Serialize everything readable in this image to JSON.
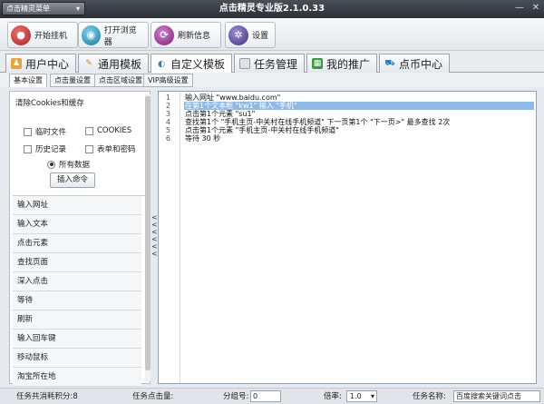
{
  "titlebar": {
    "menu_label": "点击精灵菜单",
    "menu_caret": "▾",
    "title": "点击精灵专业版2.1.0.33",
    "min": "—",
    "close": "✕"
  },
  "toolbar": {
    "buttons": [
      {
        "label": "开始挂机",
        "icon": "robot-icon",
        "color": "#c0392b"
      },
      {
        "label": "打开浏览器",
        "icon": "globe-icon",
        "color": "#1f8bb8"
      },
      {
        "label": "刷新信息",
        "icon": "refresh-icon",
        "color": "#8e2b8a"
      },
      {
        "label": "设置",
        "icon": "gear-icon",
        "color": "#4e3b8a"
      }
    ]
  },
  "tabs": [
    {
      "label": "用户中心",
      "icon": "user-icon"
    },
    {
      "label": "通用模板",
      "icon": "wand-icon"
    },
    {
      "label": "自定义模板",
      "icon": "custom-icon"
    },
    {
      "label": "任务管理",
      "icon": "task-icon"
    },
    {
      "label": "我的推广",
      "icon": "promo-icon"
    },
    {
      "label": "点币中心",
      "icon": "cart-icon"
    }
  ],
  "active_tab": 2,
  "subtabs": [
    "基本设置",
    "点击量设置",
    "点击区域设置",
    "VIP高级设置"
  ],
  "left": {
    "group_title": "清除Cookies和缓存",
    "checkboxes": [
      {
        "label": "临时文件",
        "checked": false
      },
      {
        "label": "COOKIES",
        "checked": false
      },
      {
        "label": "历史记录",
        "checked": false
      },
      {
        "label": "表单和密码",
        "checked": false
      }
    ],
    "radio_label": "所有数据",
    "insert_button": "插入命令",
    "commands": [
      "输入网址",
      "输入文本",
      "点击元素",
      "查找页面",
      "深入点击",
      "等待",
      "刷新",
      "输入回车键",
      "移动鼠标",
      "淘宝所在地"
    ]
  },
  "collapse_arrows": "<\n<\n<\n<\n<\n<",
  "editor": {
    "line_numbers": [
      "1",
      "2",
      "3",
      "4",
      "5",
      "6"
    ],
    "lines": [
      "输入网址 \"www.baidu.com\"",
      "在第1个文本框 \"kw1\" 输入 \"手机\"",
      "点击第1个元素 \"su1\"",
      "查找第1个 \"手机主页-中关村在线手机频道\" 下一页第1个 \"下一页>\" 最多查找 2次",
      "点击第1个元素 \"手机主页-中关村在线手机频道\"",
      "等待 30 秒"
    ],
    "selected_line": 2
  },
  "status": {
    "points_label": "任务共消耗积分:8",
    "clicks_label": "任务点击量:",
    "group_label": "分组号:",
    "group_value": "0",
    "rate_label": "倍率:",
    "rate_value": "1.0",
    "rate_caret": "▾",
    "name_label": "任务名称:",
    "name_value": "百度搜索关键词点击"
  }
}
